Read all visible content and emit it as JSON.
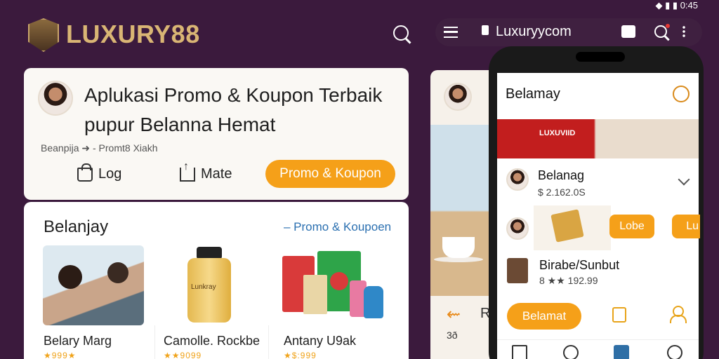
{
  "status_bar": {
    "time": "0:45",
    "icons": "◆ ▮ ▮"
  },
  "brand": {
    "name": "LUXURY88",
    "logo_icon": "shield-crest-icon",
    "accent": "#d9b574"
  },
  "browser": {
    "url": "Luxuryycom"
  },
  "hero": {
    "title_line1": "Aplukasi Promo & Koupon Terbaik",
    "title_line2": "pupur Belanna Hemat",
    "subtitle": "Beanpija ➜ - Promt8 Xiakh",
    "log_label": "Log",
    "mate_label": "Mate",
    "promo_button": "Promo & Koupon"
  },
  "shop": {
    "title": "Belanjay",
    "link": "– Promo & Koupoen",
    "products": [
      {
        "name": "Belary Marg",
        "rating": "★999★"
      },
      {
        "name": "Camolle. Rockbe",
        "rating": "★★9099"
      },
      {
        "name": "Antany U9ak",
        "rating": "★$:999"
      }
    ],
    "bottle_label": "Lunkray"
  },
  "tablet": {
    "back_text": "R",
    "footer_text": "3ð"
  },
  "phone": {
    "header_title": "Belamay",
    "banner_text": "LUXUVIID",
    "rows": [
      {
        "name": "Belanag",
        "price": "$ 2.162.0S"
      },
      {
        "name": "Birabe/Sunbut",
        "price": "8 ★★ 192.99"
      }
    ],
    "lobe_label": "Lobe",
    "lobe_label2": "Lu",
    "primary_button": "Belamat"
  },
  "colors": {
    "background": "#3b1a3d",
    "orange": "#f5a019",
    "link_blue": "#2a6fb0"
  }
}
